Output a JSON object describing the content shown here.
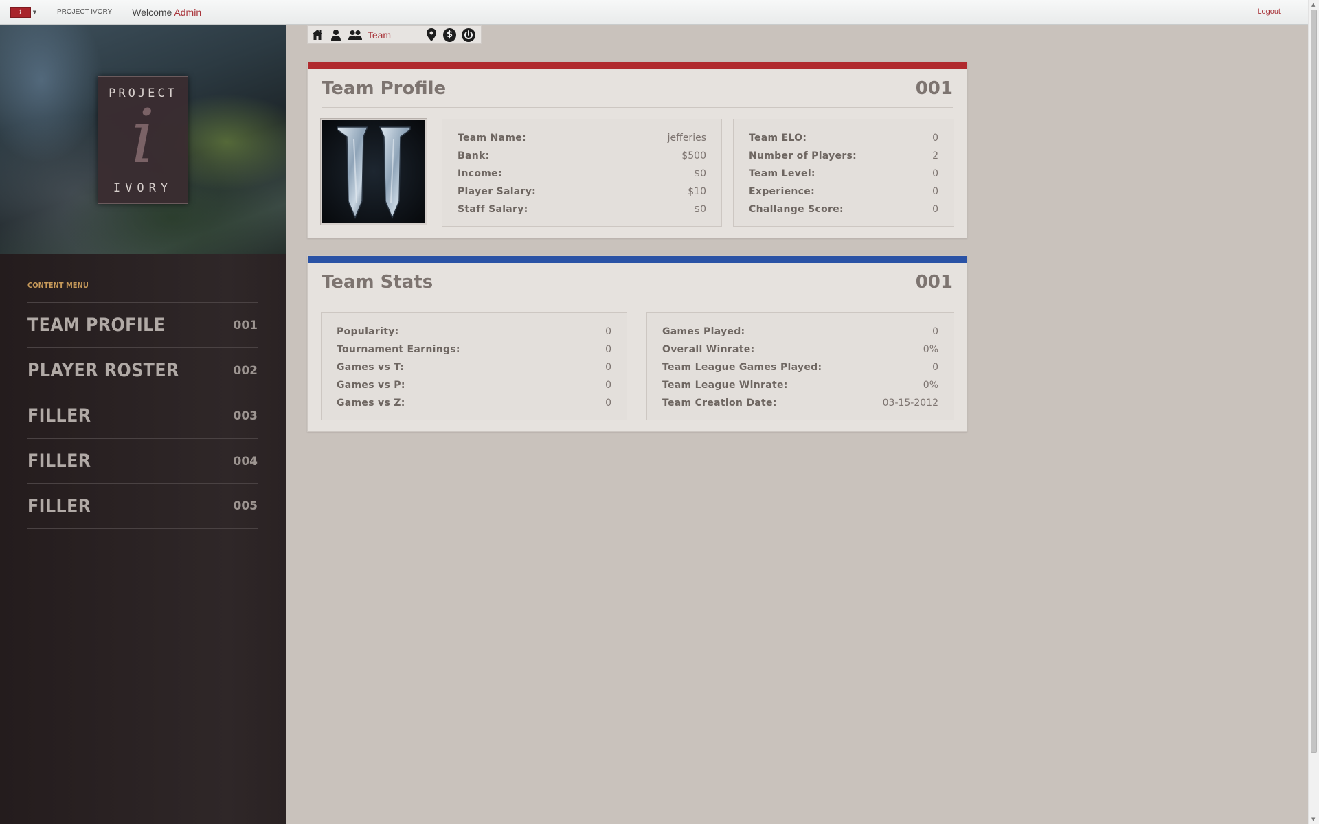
{
  "topbar": {
    "brand_letter": "i",
    "site_name": "PROJECT IVORY",
    "welcome_prefix": "Welcome",
    "welcome_user": "Admin",
    "logout": "Logout"
  },
  "sidebar": {
    "logo_top": "PROJECT",
    "logo_letter": "i",
    "logo_bottom": "IVORY",
    "menu_heading": "CONTENT MENU",
    "items": [
      {
        "label": "TEAM PROFILE",
        "num": "001"
      },
      {
        "label": "PLAYER ROSTER",
        "num": "002"
      },
      {
        "label": "FILLER",
        "num": "003"
      },
      {
        "label": "FILLER",
        "num": "004"
      },
      {
        "label": "FILLER",
        "num": "005"
      }
    ]
  },
  "toolbar": {
    "icons": [
      "home-icon",
      "user-icon",
      "users-icon",
      "map-pin-icon",
      "dollar-icon",
      "power-icon"
    ],
    "label": "Team"
  },
  "profile": {
    "title": "Team Profile",
    "num": "001",
    "bar_color": "#b02a2e",
    "left": [
      {
        "label": "Team Name:",
        "value": "jefferies"
      },
      {
        "label": "Bank:",
        "value": "$500"
      },
      {
        "label": "Income:",
        "value": "$0"
      },
      {
        "label": "Player Salary:",
        "value": "$10"
      },
      {
        "label": "Staff Salary:",
        "value": "$0"
      }
    ],
    "right": [
      {
        "label": "Team ELO:",
        "value": "0"
      },
      {
        "label": "Number of Players:",
        "value": "2"
      },
      {
        "label": "Team Level:",
        "value": "0"
      },
      {
        "label": "Experience:",
        "value": "0"
      },
      {
        "label": "Challange Score:",
        "value": "0"
      }
    ]
  },
  "stats": {
    "title": "Team Stats",
    "num": "001",
    "bar_color": "#2a52a5",
    "left": [
      {
        "label": "Popularity:",
        "value": "0"
      },
      {
        "label": "Tournament Earnings:",
        "value": "0"
      },
      {
        "label": "Games vs T:",
        "value": "0"
      },
      {
        "label": "Games vs P:",
        "value": "0"
      },
      {
        "label": "Games vs Z:",
        "value": "0"
      }
    ],
    "right": [
      {
        "label": "Games Played:",
        "value": "0"
      },
      {
        "label": "Overall Winrate:",
        "value": "0%"
      },
      {
        "label": "Team League Games Played:",
        "value": "0"
      },
      {
        "label": "Team League Winrate:",
        "value": "0%"
      },
      {
        "label": "Team Creation Date:",
        "value": "03-15-2012"
      }
    ]
  }
}
